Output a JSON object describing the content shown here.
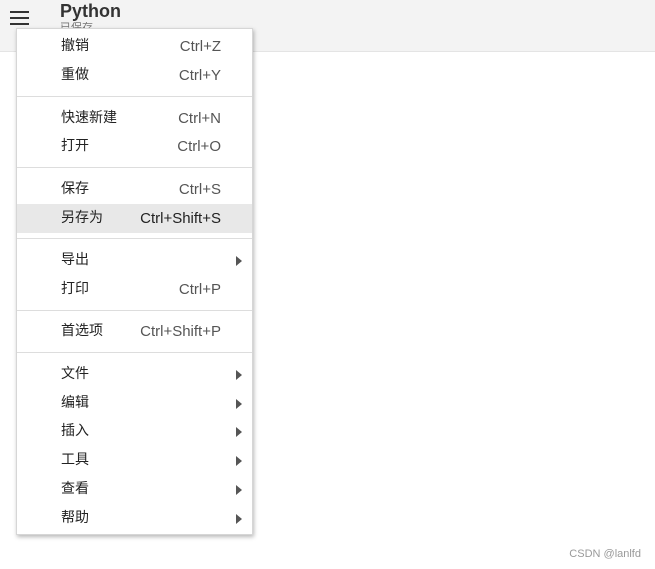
{
  "app": {
    "title": "Python",
    "subtitle": "已保存"
  },
  "menu": {
    "items": [
      {
        "label": "撤销",
        "shortcut": "Ctrl+Z"
      },
      {
        "label": "重做",
        "shortcut": "Ctrl+Y"
      },
      {
        "label": "快速新建",
        "shortcut": "Ctrl+N"
      },
      {
        "label": "打开",
        "shortcut": "Ctrl+O"
      },
      {
        "label": "保存",
        "shortcut": "Ctrl+S"
      },
      {
        "label": "另存为",
        "shortcut": "Ctrl+Shift+S",
        "highlighted": true
      },
      {
        "label": "导出",
        "submenu": true
      },
      {
        "label": "打印",
        "shortcut": "Ctrl+P"
      },
      {
        "label": "首选项",
        "shortcut": "Ctrl+Shift+P"
      },
      {
        "label": "文件",
        "submenu": true
      },
      {
        "label": "编辑",
        "submenu": true
      },
      {
        "label": "插入",
        "submenu": true
      },
      {
        "label": "工具",
        "submenu": true
      },
      {
        "label": "查看",
        "submenu": true
      },
      {
        "label": "帮助",
        "submenu": true
      }
    ]
  },
  "watermark": "CSDN @lanlfd",
  "colors": {
    "highlight": "#e8e8e8",
    "topbar": "#f3f3f3"
  },
  "icons": {
    "menu": "hamburger-icon",
    "submenu": "triangle-right-icon"
  }
}
